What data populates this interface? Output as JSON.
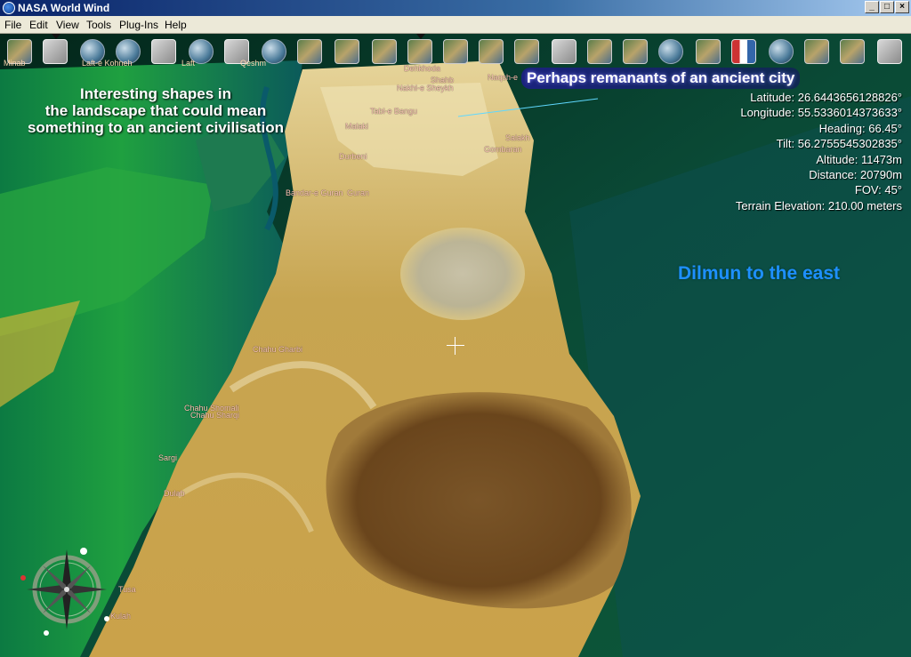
{
  "window": {
    "title": "NASA World Wind",
    "min_label": "_",
    "max_label": "□",
    "close_label": "×"
  },
  "menu": [
    "File",
    "Edit",
    "View",
    "Tools",
    "Plug-Ins",
    "Help"
  ],
  "info": {
    "latitude": "Latitude: 26.6443656128826°",
    "longitude": "Longitude: 55.5336014373633°",
    "heading": "Heading: 66.45°",
    "tilt": "Tilt: 56.2755545302835°",
    "altitude": "Altitude: 11473m",
    "distance": "Distance: 20790m",
    "fov": "FOV: 45°",
    "terrain": "Terrain Elevation: 210.00 meters"
  },
  "annotations": {
    "shapes_l1": "Interesting  shapes in",
    "shapes_l2": "the landscape that could mean",
    "shapes_l3": "something to an ancient civilisation",
    "city": "Perhaps remanants of an ancient city",
    "dilmun": "Dilmun to the east"
  },
  "places": {
    "dehkhoda": "Dehkhoda",
    "nakhl": "Nakhl-e Sheykh",
    "shahb": "Shahb",
    "naqsh": "Naqsh-e",
    "tabl_bangu": "Tabl-e Bangu",
    "salakh": "Salakh",
    "gombaran": "Gombaran",
    "malaki": "Malaki",
    "durbeni": "Durbeni",
    "bandar_guran": "Bandar-e Guran",
    "guran": "Guran",
    "chahu_gharbi": "Chahu Gharbi",
    "chahu_shomali": "Chahu Shomali",
    "chahu_sharqi": "Chahu Sharqi",
    "sargi": "Sargi",
    "dulab": "Dulab",
    "tusa": "Tusa",
    "kulah": "Kulah",
    "lafi": "Laft",
    "qevshm": "Qeshm",
    "latte_kohneh": "Laft-e Kohneh",
    "mitsfam": "Minab"
  },
  "colors": {
    "sea_deep": "#062a1e",
    "island_light": "#d8c07a",
    "island_dark": "#6a4a1c",
    "coast_green": "#2e9a3a",
    "accent_blue": "#1e90ff"
  }
}
